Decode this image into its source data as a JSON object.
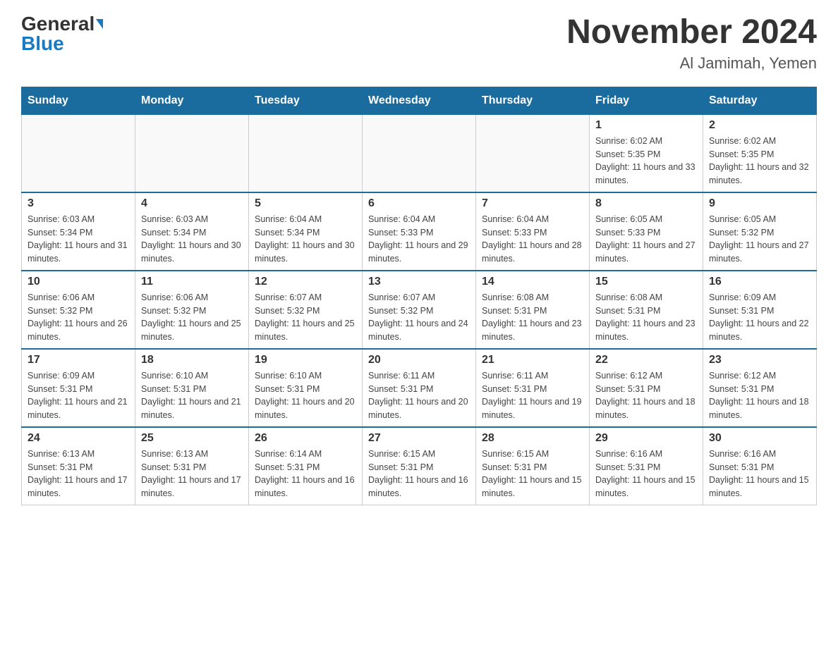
{
  "header": {
    "logo_general": "General",
    "logo_blue": "Blue",
    "title": "November 2024",
    "subtitle": "Al Jamimah, Yemen"
  },
  "weekdays": [
    "Sunday",
    "Monday",
    "Tuesday",
    "Wednesday",
    "Thursday",
    "Friday",
    "Saturday"
  ],
  "weeks": [
    [
      {
        "day": "",
        "info": ""
      },
      {
        "day": "",
        "info": ""
      },
      {
        "day": "",
        "info": ""
      },
      {
        "day": "",
        "info": ""
      },
      {
        "day": "",
        "info": ""
      },
      {
        "day": "1",
        "info": "Sunrise: 6:02 AM\nSunset: 5:35 PM\nDaylight: 11 hours and 33 minutes."
      },
      {
        "day": "2",
        "info": "Sunrise: 6:02 AM\nSunset: 5:35 PM\nDaylight: 11 hours and 32 minutes."
      }
    ],
    [
      {
        "day": "3",
        "info": "Sunrise: 6:03 AM\nSunset: 5:34 PM\nDaylight: 11 hours and 31 minutes."
      },
      {
        "day": "4",
        "info": "Sunrise: 6:03 AM\nSunset: 5:34 PM\nDaylight: 11 hours and 30 minutes."
      },
      {
        "day": "5",
        "info": "Sunrise: 6:04 AM\nSunset: 5:34 PM\nDaylight: 11 hours and 30 minutes."
      },
      {
        "day": "6",
        "info": "Sunrise: 6:04 AM\nSunset: 5:33 PM\nDaylight: 11 hours and 29 minutes."
      },
      {
        "day": "7",
        "info": "Sunrise: 6:04 AM\nSunset: 5:33 PM\nDaylight: 11 hours and 28 minutes."
      },
      {
        "day": "8",
        "info": "Sunrise: 6:05 AM\nSunset: 5:33 PM\nDaylight: 11 hours and 27 minutes."
      },
      {
        "day": "9",
        "info": "Sunrise: 6:05 AM\nSunset: 5:32 PM\nDaylight: 11 hours and 27 minutes."
      }
    ],
    [
      {
        "day": "10",
        "info": "Sunrise: 6:06 AM\nSunset: 5:32 PM\nDaylight: 11 hours and 26 minutes."
      },
      {
        "day": "11",
        "info": "Sunrise: 6:06 AM\nSunset: 5:32 PM\nDaylight: 11 hours and 25 minutes."
      },
      {
        "day": "12",
        "info": "Sunrise: 6:07 AM\nSunset: 5:32 PM\nDaylight: 11 hours and 25 minutes."
      },
      {
        "day": "13",
        "info": "Sunrise: 6:07 AM\nSunset: 5:32 PM\nDaylight: 11 hours and 24 minutes."
      },
      {
        "day": "14",
        "info": "Sunrise: 6:08 AM\nSunset: 5:31 PM\nDaylight: 11 hours and 23 minutes."
      },
      {
        "day": "15",
        "info": "Sunrise: 6:08 AM\nSunset: 5:31 PM\nDaylight: 11 hours and 23 minutes."
      },
      {
        "day": "16",
        "info": "Sunrise: 6:09 AM\nSunset: 5:31 PM\nDaylight: 11 hours and 22 minutes."
      }
    ],
    [
      {
        "day": "17",
        "info": "Sunrise: 6:09 AM\nSunset: 5:31 PM\nDaylight: 11 hours and 21 minutes."
      },
      {
        "day": "18",
        "info": "Sunrise: 6:10 AM\nSunset: 5:31 PM\nDaylight: 11 hours and 21 minutes."
      },
      {
        "day": "19",
        "info": "Sunrise: 6:10 AM\nSunset: 5:31 PM\nDaylight: 11 hours and 20 minutes."
      },
      {
        "day": "20",
        "info": "Sunrise: 6:11 AM\nSunset: 5:31 PM\nDaylight: 11 hours and 20 minutes."
      },
      {
        "day": "21",
        "info": "Sunrise: 6:11 AM\nSunset: 5:31 PM\nDaylight: 11 hours and 19 minutes."
      },
      {
        "day": "22",
        "info": "Sunrise: 6:12 AM\nSunset: 5:31 PM\nDaylight: 11 hours and 18 minutes."
      },
      {
        "day": "23",
        "info": "Sunrise: 6:12 AM\nSunset: 5:31 PM\nDaylight: 11 hours and 18 minutes."
      }
    ],
    [
      {
        "day": "24",
        "info": "Sunrise: 6:13 AM\nSunset: 5:31 PM\nDaylight: 11 hours and 17 minutes."
      },
      {
        "day": "25",
        "info": "Sunrise: 6:13 AM\nSunset: 5:31 PM\nDaylight: 11 hours and 17 minutes."
      },
      {
        "day": "26",
        "info": "Sunrise: 6:14 AM\nSunset: 5:31 PM\nDaylight: 11 hours and 16 minutes."
      },
      {
        "day": "27",
        "info": "Sunrise: 6:15 AM\nSunset: 5:31 PM\nDaylight: 11 hours and 16 minutes."
      },
      {
        "day": "28",
        "info": "Sunrise: 6:15 AM\nSunset: 5:31 PM\nDaylight: 11 hours and 15 minutes."
      },
      {
        "day": "29",
        "info": "Sunrise: 6:16 AM\nSunset: 5:31 PM\nDaylight: 11 hours and 15 minutes."
      },
      {
        "day": "30",
        "info": "Sunrise: 6:16 AM\nSunset: 5:31 PM\nDaylight: 11 hours and 15 minutes."
      }
    ]
  ]
}
